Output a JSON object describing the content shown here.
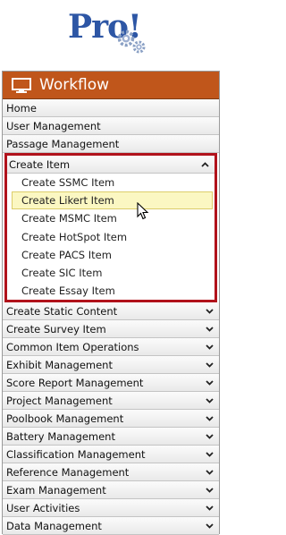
{
  "logo": {
    "text": "Pro!"
  },
  "panel": {
    "title": "Workflow",
    "icon": "monitor-icon",
    "accent": "#c0561b",
    "highlight": "#b1121b"
  },
  "menu_before": [
    {
      "label": "Home"
    },
    {
      "label": "User Management"
    },
    {
      "label": "Passage Management"
    }
  ],
  "open_group": {
    "label": "Create Item",
    "items": [
      {
        "label": "Create SSMC Item"
      },
      {
        "label": "Create Likert Item"
      },
      {
        "label": "Create MSMC Item"
      },
      {
        "label": "Create HotSpot Item"
      },
      {
        "label": "Create PACS Item"
      },
      {
        "label": "Create SIC Item"
      },
      {
        "label": "Create Essay Item"
      }
    ]
  },
  "menu_after": [
    {
      "label": "Create Static Content"
    },
    {
      "label": "Create Survey Item"
    },
    {
      "label": "Common Item Operations"
    },
    {
      "label": "Exhibit Management"
    },
    {
      "label": "Score Report Management"
    },
    {
      "label": "Project Management"
    },
    {
      "label": "Poolbook Management"
    },
    {
      "label": "Battery Management"
    },
    {
      "label": "Classification Management"
    },
    {
      "label": "Reference Management"
    },
    {
      "label": "Exam Management"
    },
    {
      "label": "User Activities"
    },
    {
      "label": "Data Management"
    }
  ]
}
